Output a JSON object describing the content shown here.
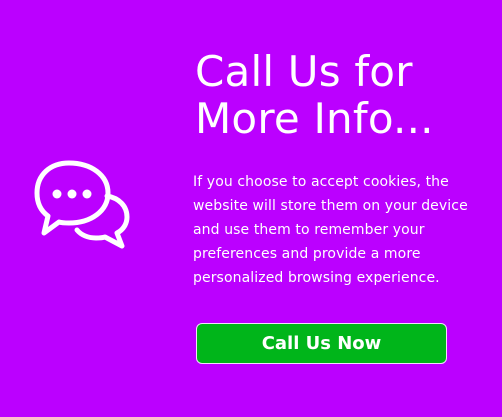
{
  "banner": {
    "title": "Call Us for More Info...",
    "description": "If you choose to accept cookies, the website will store them on your device and use them to remember your preferences and provide a more personalized browsing experience.",
    "icon": "chat-bubbles-icon",
    "button_label": "Call Us Now"
  },
  "colors": {
    "background": "#bb00ff",
    "text": "#ffffff",
    "button": "#00b51a",
    "button_border": "#f3dcff"
  }
}
